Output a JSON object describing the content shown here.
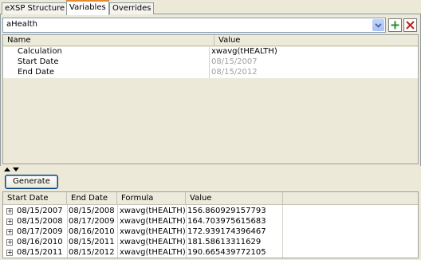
{
  "tabs": [
    {
      "label": "eXSP Structure",
      "active": false
    },
    {
      "label": "Variables",
      "active": true
    },
    {
      "label": "Overrides",
      "active": false
    }
  ],
  "variable_selector": {
    "value": "aHealth"
  },
  "variables_table": {
    "columns": [
      "Name",
      "Value"
    ],
    "rows": [
      {
        "name": "Calculation",
        "value": "xwavg(tHEALTH)",
        "muted": false
      },
      {
        "name": "Start Date",
        "value": "08/15/2007",
        "muted": true
      },
      {
        "name": "End Date",
        "value": "08/15/2012",
        "muted": true
      }
    ]
  },
  "generate_button": {
    "label": "Generate"
  },
  "results_table": {
    "columns": [
      "Start Date",
      "End Date",
      "Formula",
      "Value"
    ],
    "rows": [
      {
        "start": "08/15/2007",
        "end": "08/15/2008",
        "formula": "xwavg(tHEALTH)",
        "value": "156.860929157793"
      },
      {
        "start": "08/15/2008",
        "end": "08/17/2009",
        "formula": "xwavg(tHEALTH)",
        "value": "164.703975615683"
      },
      {
        "start": "08/17/2009",
        "end": "08/16/2010",
        "formula": "xwavg(tHEALTH)",
        "value": "172.939174396467"
      },
      {
        "start": "08/16/2010",
        "end": "08/15/2011",
        "formula": "xwavg(tHEALTH)",
        "value": "181.58613311629"
      },
      {
        "start": "08/15/2011",
        "end": "08/15/2012",
        "formula": "xwavg(tHEALTH)",
        "value": "190.665439772105"
      }
    ]
  },
  "colors": {
    "accent_tab": "#e68b2c",
    "add_icon": "#2a8f2a",
    "remove_icon": "#c02020"
  },
  "icons": {
    "combo_arrow": "chevron-down-icon",
    "add": "plus-icon",
    "remove": "close-icon",
    "splitter": "splitter-arrows-icon",
    "expander": "expand-plus-icon"
  }
}
